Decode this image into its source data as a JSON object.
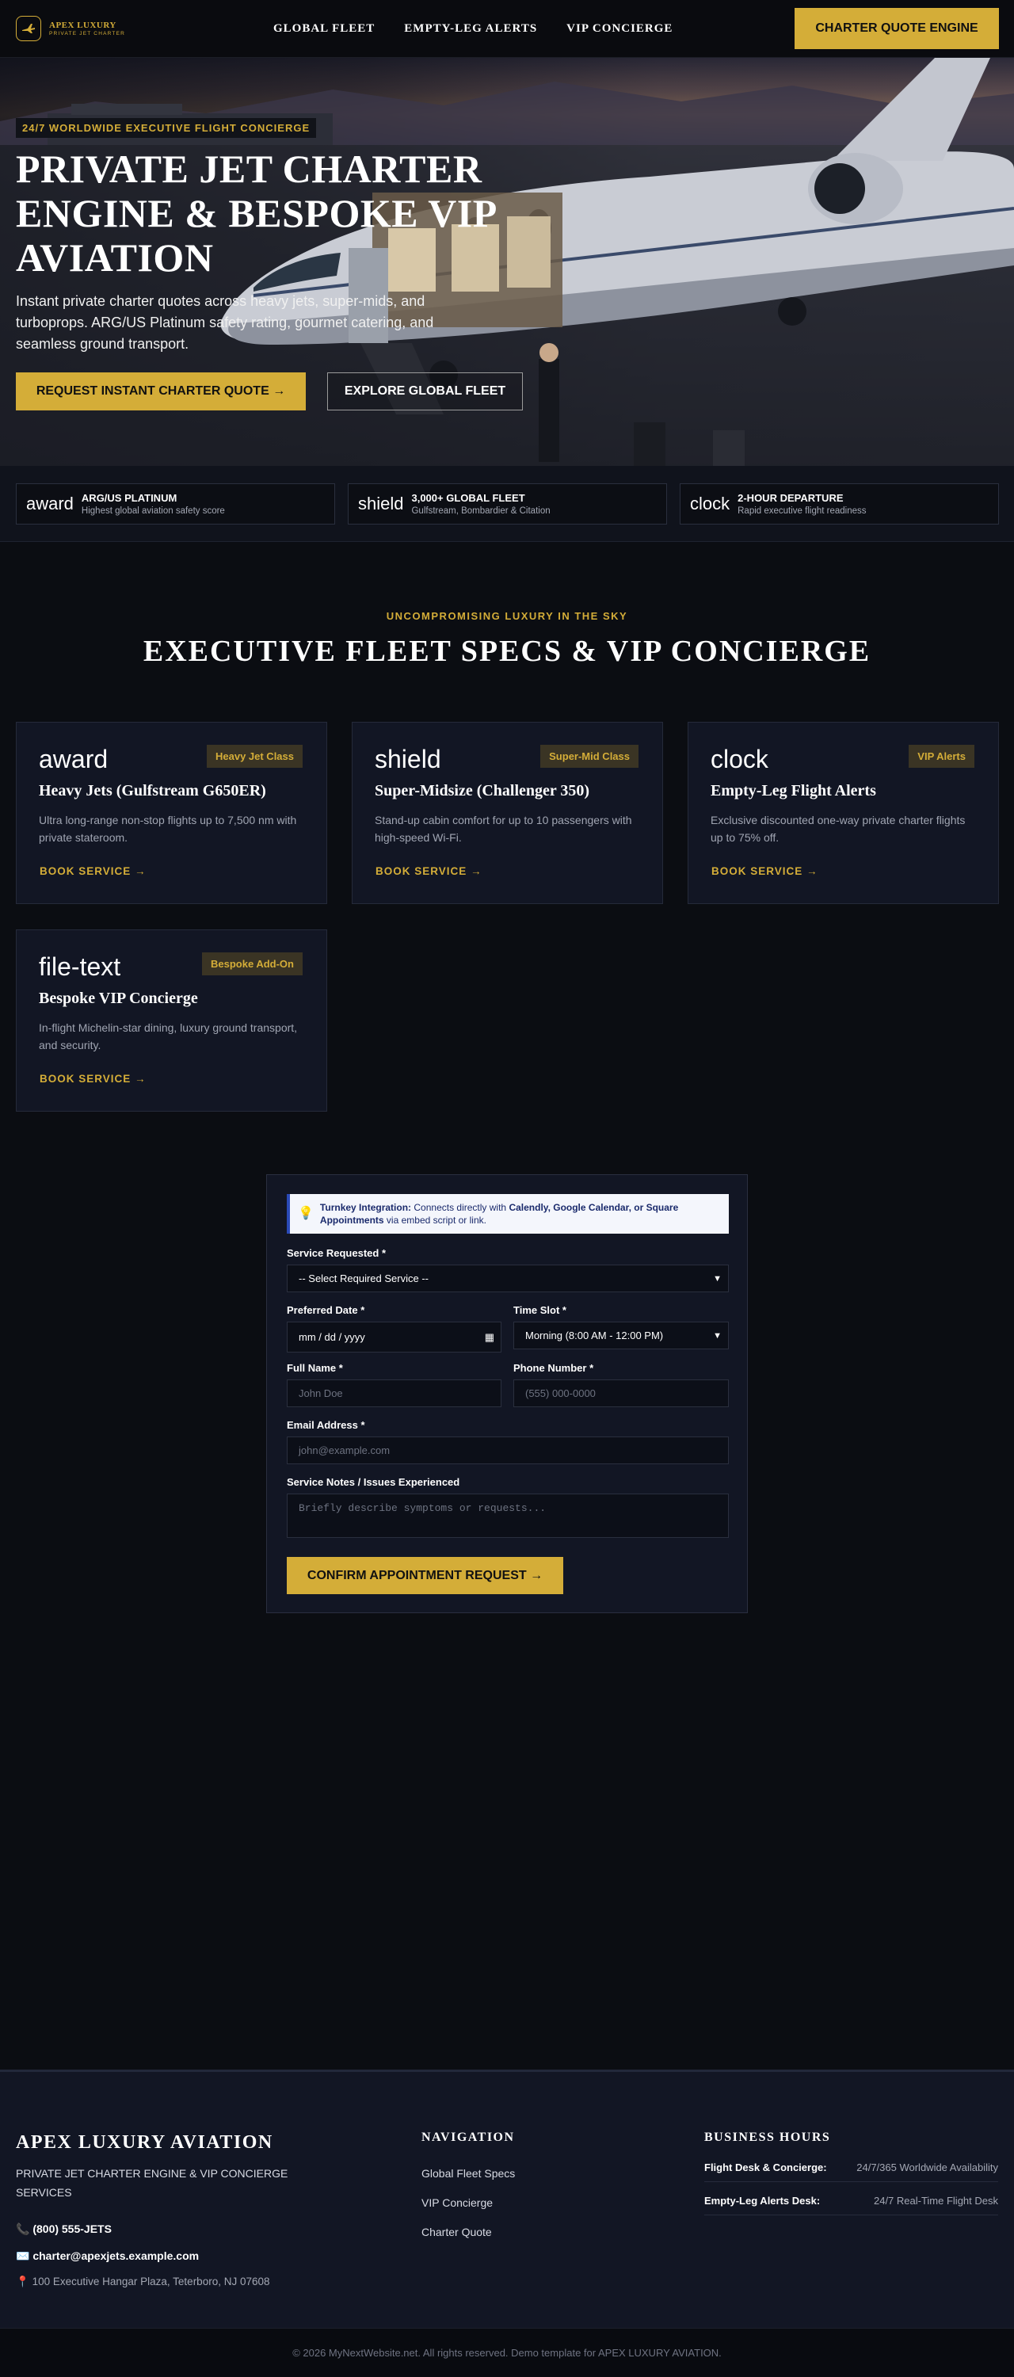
{
  "brand": {
    "name_line1": "APEX LUXURY",
    "name_line2": "PRIVATE JET CHARTER"
  },
  "nav": {
    "items": [
      "GLOBAL FLEET",
      "EMPTY-LEG ALERTS",
      "VIP CONCIERGE"
    ],
    "cta": "CHARTER QUOTE ENGINE"
  },
  "hero": {
    "eyebrow": "24/7 WORLDWIDE EXECUTIVE FLIGHT CONCIERGE",
    "title": "PRIVATE JET CHARTER ENGINE & BESPOKE VIP AVIATION",
    "subtitle": "Instant private charter quotes across heavy jets, super-mids, and turboprops. ARG/US Platinum safety rating, gourmet catering, and seamless ground transport.",
    "primary_cta": "REQUEST INSTANT CHARTER QUOTE →",
    "secondary_cta": "EXPLORE GLOBAL FLEET"
  },
  "stats": [
    {
      "icon": "award",
      "title": "ARG/US PLATINUM",
      "desc": "Highest global aviation safety score"
    },
    {
      "icon": "shield",
      "title": "3,000+ GLOBAL FLEET",
      "desc": "Gulfstream, Bombardier & Citation"
    },
    {
      "icon": "clock",
      "title": "2-HOUR DEPARTURE",
      "desc": "Rapid executive flight readiness"
    }
  ],
  "services": {
    "eyebrow": "UNCOMPROMISING LUXURY IN THE SKY",
    "title": "EXECUTIVE FLEET SPECS & VIP CONCIERGE",
    "cards": [
      {
        "icon": "award",
        "badge": "Heavy Jet Class",
        "title": "Heavy Jets (Gulfstream G650ER)",
        "desc": "Ultra long-range non-stop flights up to 7,500 nm with private stateroom.",
        "link": "BOOK SERVICE →"
      },
      {
        "icon": "shield",
        "badge": "Super-Mid Class",
        "title": "Super-Midsize (Challenger 350)",
        "desc": "Stand-up cabin comfort for up to 10 passengers with high-speed Wi-Fi.",
        "link": "BOOK SERVICE →"
      },
      {
        "icon": "clock",
        "badge": "VIP Alerts",
        "title": "Empty-Leg Flight Alerts",
        "desc": "Exclusive discounted one-way private charter flights up to 75% off.",
        "link": "BOOK SERVICE →"
      },
      {
        "icon": "file-text",
        "badge": "Bespoke Add-On",
        "title": "Bespoke VIP Concierge",
        "desc": "In-flight Michelin-star dining, luxury ground transport, and security.",
        "link": "BOOK SERVICE →"
      }
    ]
  },
  "form": {
    "note_bold": "Turnkey Integration:",
    "note_text1": " Connects directly with ",
    "note_bold2": "Calendly, Google Calendar, or Square Appointments",
    "note_text2": " via embed script or link.",
    "service_label": "Service Requested *",
    "service_value": "-- Select Required Service --",
    "date_label": "Preferred Date *",
    "date_value": "mm / dd / yyyy",
    "time_label": "Time Slot *",
    "time_value": "Morning (8:00 AM - 12:00 PM)",
    "name_label": "Full Name *",
    "name_placeholder": "John Doe",
    "phone_label": "Phone Number *",
    "phone_placeholder": "(555) 000-0000",
    "email_label": "Email Address *",
    "email_placeholder": "john@example.com",
    "notes_label": "Service Notes / Issues Experienced",
    "notes_placeholder": "Briefly describe symptoms or requests...",
    "submit": "CONFIRM APPOINTMENT REQUEST →"
  },
  "footer": {
    "brand": "APEX LUXURY AVIATION",
    "tagline": "PRIVATE JET CHARTER ENGINE & VIP CONCIERGE SERVICES",
    "phone": "(800) 555-JETS",
    "email": "charter@apexjets.example.com",
    "address": "100 Executive Hangar Plaza, Teterboro, NJ 07608",
    "nav_heading": "NAVIGATION",
    "nav_links": [
      "Global Fleet Specs",
      "VIP Concierge",
      "Charter Quote"
    ],
    "hours_heading": "BUSINESS HOURS",
    "hours": [
      {
        "label": "Flight Desk & Concierge:",
        "value": "24/7/365 Worldwide Availability"
      },
      {
        "label": "Empty-Leg Alerts Desk:",
        "value": "24/7 Real-Time Flight Desk"
      }
    ],
    "copyright": "© 2026 MyNextWebsite.net. All rights reserved. Demo template for APEX LUXURY AVIATION."
  },
  "colors": {
    "accent": "#d4ad38",
    "background": "#0b0d12",
    "card": "#121624"
  }
}
